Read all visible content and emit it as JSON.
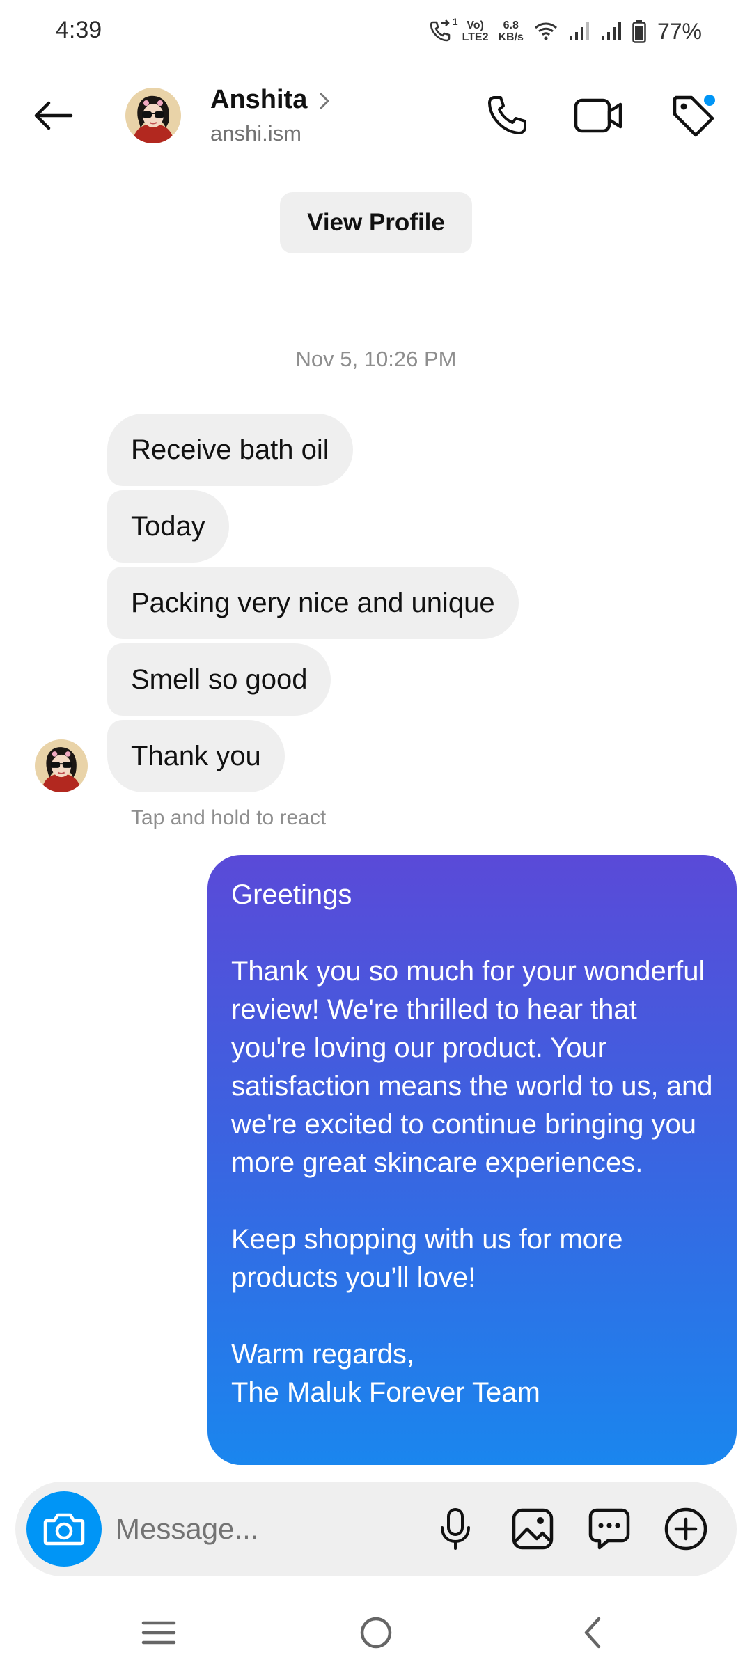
{
  "status_bar": {
    "time": "4:39",
    "volte": "Vo) LTE2",
    "volte_top": "Vo)",
    "volte_bottom": "LTE2",
    "sim_label": "1",
    "data_rate_value": "6.8",
    "data_rate_unit": "KB/s",
    "battery": "77%",
    "battery_level": 0.77
  },
  "header": {
    "contact_name": "Anshita",
    "contact_handle": "anshi.ism",
    "icons": [
      "back-arrow-icon",
      "phone-icon",
      "video-camera-icon",
      "tag-icon"
    ],
    "notification_dot_color": "#0095f6"
  },
  "view_profile_label": "View Profile",
  "timestamp": "Nov 5, 10:26 PM",
  "incoming_messages": [
    "Receive bath oil",
    "Today",
    "Packing very nice and unique",
    "Smell so good",
    "Thank you"
  ],
  "react_hint": "Tap and hold to react",
  "outgoing_message": {
    "greeting": "Greetings",
    "body1": "Thank you so much for your wonderful review! We're thrilled to hear that you're loving our product. Your satisfaction means the world to us, and we're excited to continue bringing you more great skincare experiences.",
    "body2": "Keep shopping with us for more products you’ll love!",
    "closing": "Warm regards,",
    "signature": "The Maluk Forever Team",
    "gradient_top": "#5a4ad8",
    "gradient_bottom": "#1a86ee"
  },
  "composer": {
    "placeholder": "Message...",
    "camera_button_color": "#0095f6",
    "icons": [
      "camera-icon",
      "microphone-icon",
      "gallery-icon",
      "sticker-icon",
      "plus-icon"
    ]
  },
  "nav_bar": {
    "icons": [
      "menu-icon",
      "home-icon",
      "back-icon"
    ]
  }
}
